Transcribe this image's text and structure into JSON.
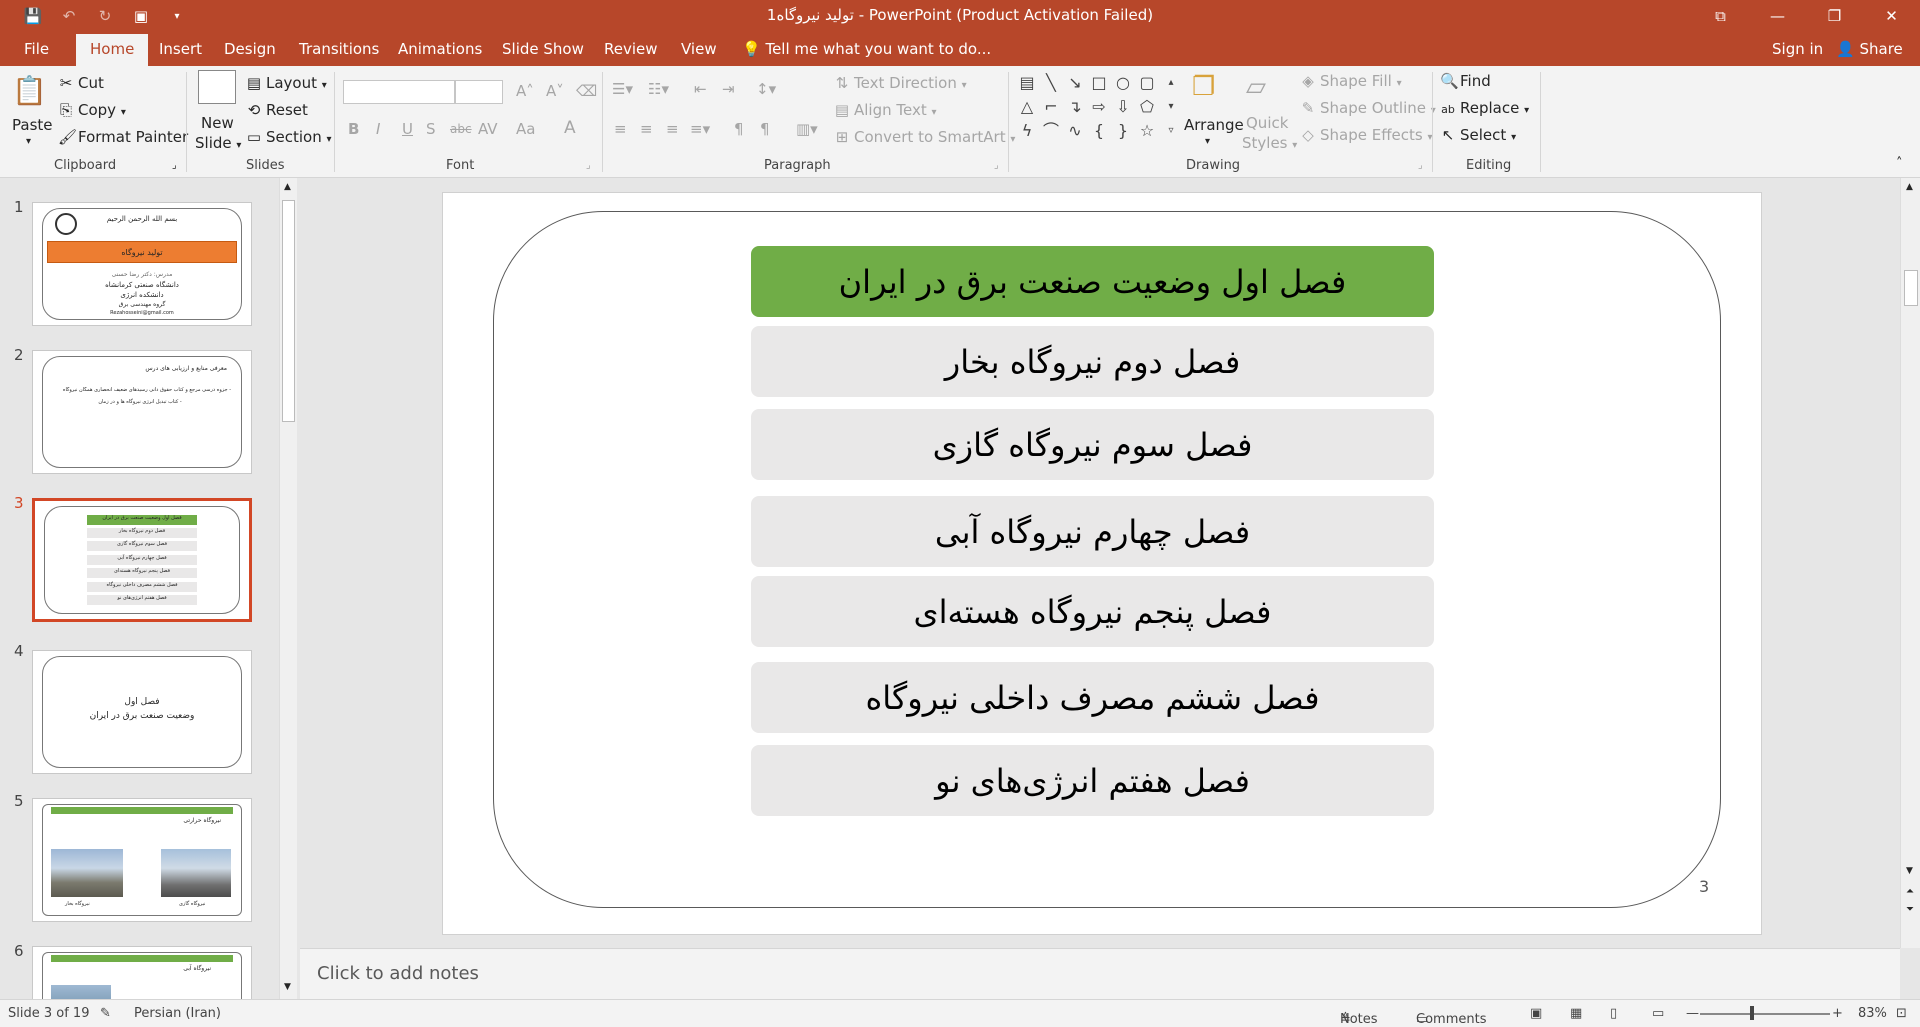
{
  "titlebar": {
    "title": "تولید نیروگاه1 - PowerPoint (Product Activation Failed)",
    "icons": [
      "save-icon",
      "undo-icon",
      "redo-icon",
      "present-icon",
      "customize-icon"
    ]
  },
  "tabs": [
    "File",
    "Home",
    "Insert",
    "Design",
    "Transitions",
    "Animations",
    "Slide Show",
    "Review",
    "View"
  ],
  "tell_me": "Tell me what you want to do...",
  "sign_in": "Sign in",
  "share": "Share",
  "ribbon": {
    "clipboard": {
      "paste": "Paste",
      "cut": "Cut",
      "copy": "Copy",
      "format_painter": "Format Painter",
      "label": "Clipboard"
    },
    "slides": {
      "new_slide_line1": "New",
      "new_slide_line2": "Slide",
      "layout": "Layout",
      "reset": "Reset",
      "section": "Section",
      "label": "Slides"
    },
    "font": {
      "bold": "B",
      "italic": "I",
      "underline": "U",
      "shadow": "S",
      "strike": "abc",
      "spacing": "AV",
      "case": "Aa",
      "color": "A",
      "label": "Font"
    },
    "paragraph": {
      "text_direction": "Text Direction",
      "align_text": "Align Text",
      "convert_smartart": "Convert to SmartArt",
      "label": "Paragraph"
    },
    "drawing": {
      "arrange": "Arrange",
      "quick_line1": "Quick",
      "quick_line2": "Styles",
      "shape_fill": "Shape Fill",
      "shape_outline": "Shape Outline",
      "shape_effects": "Shape Effects",
      "label": "Drawing"
    },
    "editing": {
      "find": "Find",
      "replace": "Replace",
      "select": "Select",
      "label": "Editing"
    }
  },
  "thumbnails": [
    {
      "num": "1",
      "title_small": "بسم الله الرحمن الرحیم",
      "banner": "تولید نیروگاه",
      "lines": [
        "مدرس: دکتر رضا حسنی",
        "دانشگاه صنعتی کرمانشاه",
        "دانشکده انرژی",
        "گروه مهندسی برق",
        "Rezahosseini@gmail.com"
      ]
    },
    {
      "num": "2",
      "title_small": "معرفی منابع و ارزیابی های درس",
      "lines": [
        "- جزوه درسی مرجع و کتاب حقوق دانی رسیدهای ضعیف انحصاری همگان نیروگاه",
        "- کتاب تبدیل انرژی نیروگاه ها و در زمان"
      ]
    },
    {
      "num": "3",
      "lines": [
        "فصل اول وضعیت صنعت برق در ایران",
        "فصل دوم نیروگاه بخار",
        "فصل سوم نیروگاه گازی",
        "فصل چهارم نیروگاه آبی",
        "فصل پنجم نیروگاه هسته‌ای",
        "فصل ششم مصرف داخلی نیروگاه",
        "فصل هفتم انرژی‌های نو"
      ]
    },
    {
      "num": "4",
      "lines": [
        "فصل اول",
        "وضعیت صنعت برق در ایران"
      ]
    },
    {
      "num": "5",
      "lines": [
        "نیروگاه حرارتی",
        "نیروگاه بخار",
        "نیروگاه گازی"
      ]
    },
    {
      "num": "6",
      "lines": [
        "نیروگاه آبی"
      ]
    }
  ],
  "slide": {
    "chapters": [
      "فصل اول وضعیت صنعت برق در ایران",
      "فصل دوم نیروگاه بخار",
      "فصل سوم نیروگاه گازی",
      "فصل چهارم نیروگاه آبی",
      "فصل پنجم نیروگاه هسته‌ای",
      "فصل ششم مصرف داخلی نیروگاه",
      "فصل هفتم انرژی‌های نو"
    ],
    "slide_number": "3",
    "colors": {
      "highlight": "#70ad47",
      "row": "#e9e8e8",
      "accent": "#b7472a"
    }
  },
  "notes": {
    "placeholder": "Click to add notes"
  },
  "status": {
    "slide_of": "Slide 3 of 19",
    "language": "Persian (Iran)",
    "notes": "Notes",
    "comments": "Comments",
    "zoom": "83%"
  }
}
